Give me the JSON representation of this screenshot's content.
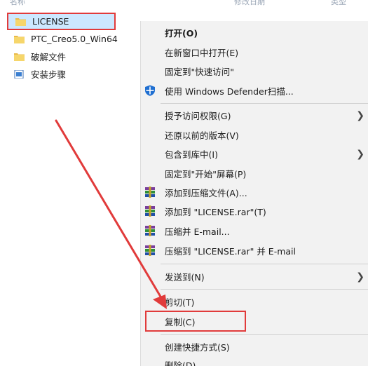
{
  "header": {
    "name_col": "名称",
    "date_col": "修改日期",
    "type_col": "类型"
  },
  "files": [
    {
      "name": "LICENSE",
      "icon": "folder-icon",
      "selected": true
    },
    {
      "name": "PTC_Creo5.0_Win64",
      "icon": "folder-icon",
      "selected": false
    },
    {
      "name": "破解文件",
      "icon": "folder-icon",
      "selected": false
    },
    {
      "name": "安装步骤",
      "icon": "document-icon",
      "selected": false
    }
  ],
  "context_menu": {
    "open": "打开(O)",
    "open_new_window": "在新窗口中打开(E)",
    "pin_quick_access": "固定到\"快速访问\"",
    "defender_scan": "使用 Windows Defender扫描...",
    "grant_access": "授予访问权限(G)",
    "restore_versions": "还原以前的版本(V)",
    "include_in_library": "包含到库中(I)",
    "pin_start": "固定到\"开始\"屏幕(P)",
    "add_to_archive": "添加到压缩文件(A)...",
    "add_to_license_rar": "添加到 \"LICENSE.rar\"(T)",
    "compress_email": "压缩并 E-mail...",
    "compress_rar_email": "压缩到 \"LICENSE.rar\" 并 E-mail",
    "send_to": "发送到(N)",
    "cut": "剪切(T)",
    "copy": "复制(C)",
    "create_shortcut": "创建快捷方式(S)",
    "delete": "删除(D)"
  },
  "colors": {
    "selection_bg": "#cce8ff",
    "annotation_red": "#e13b3b",
    "menu_bg": "#f2f2f2",
    "folder_yellow": "#f6d66b"
  }
}
